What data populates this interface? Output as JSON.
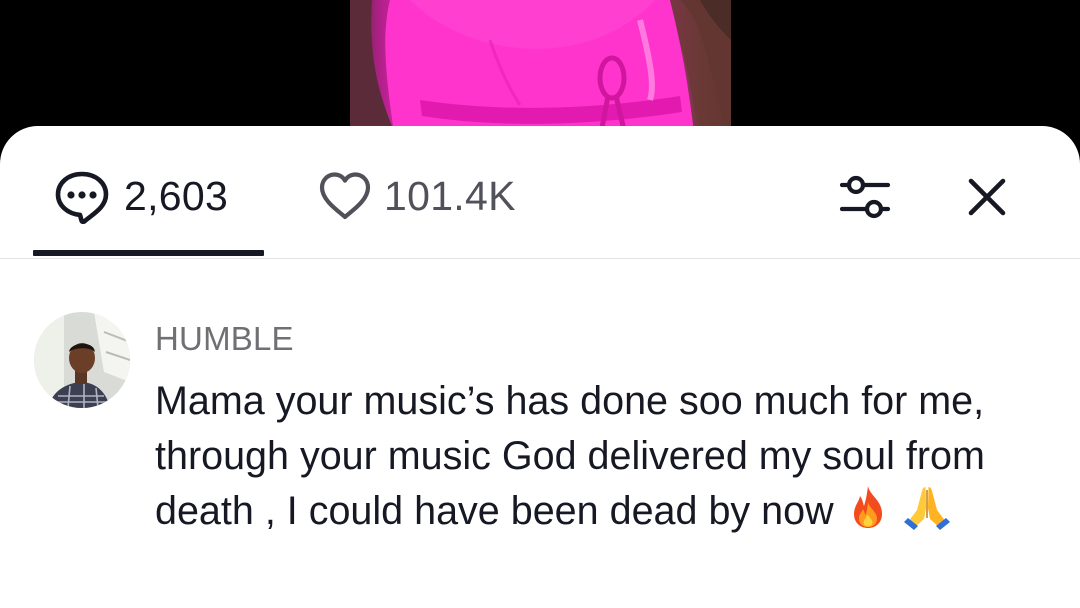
{
  "tabs": {
    "comments": {
      "icon": "comment-bubble-icon",
      "count": "2,603",
      "active": true
    },
    "likes": {
      "icon": "heart-outline-icon",
      "count": "101.4K"
    }
  },
  "toolbar": {
    "filter_icon": "sliders-filter-icon",
    "close_icon": "close-x-icon"
  },
  "comment": {
    "username": "HUMBLE",
    "avatar_icon": "user-avatar",
    "text": "Mama your music’s has done soo much for me, through your music God delivered my soul from death , I could have been dead by now",
    "emojis": [
      "fire-emoji",
      "praying-hands-emoji"
    ]
  },
  "colors": {
    "video_accent": "#ff2bc8",
    "text_primary": "#161823",
    "text_secondary": "#6f6f74",
    "divider": "#e3e3e3"
  }
}
